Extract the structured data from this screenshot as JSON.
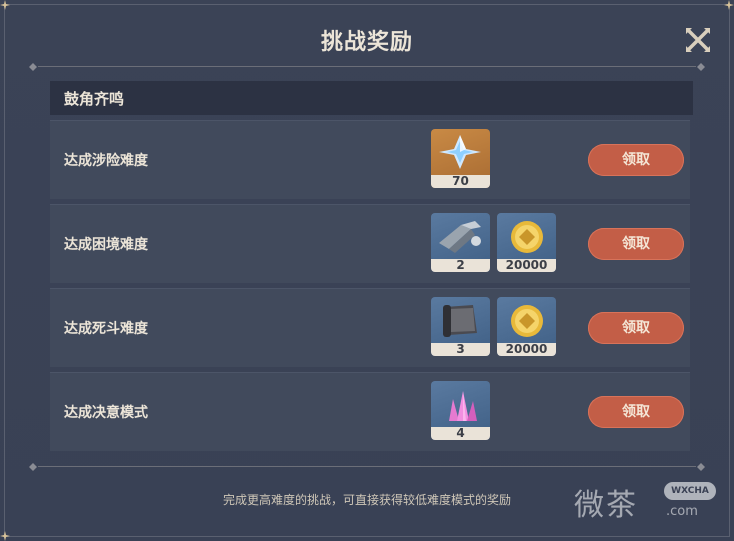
{
  "dialog": {
    "title": "挑战奖励",
    "section_title": "鼓角齐鸣",
    "footer_note": "完成更高难度的挑战，可直接获得较低难度模式的奖励"
  },
  "rows": [
    {
      "label": "达成涉险难度",
      "button": "领取",
      "items": [
        {
          "icon": "primogem-icon",
          "count": "70",
          "rarity": "orange"
        }
      ]
    },
    {
      "label": "达成困境难度",
      "button": "领取",
      "items": [
        {
          "icon": "weapon-ore-icon",
          "count": "2",
          "rarity": "blue"
        },
        {
          "icon": "mora-coin-icon",
          "count": "20000",
          "rarity": "blue"
        }
      ]
    },
    {
      "label": "达成死斗难度",
      "button": "领取",
      "items": [
        {
          "icon": "scroll-material-icon",
          "count": "3",
          "rarity": "blue"
        },
        {
          "icon": "mora-coin-icon",
          "count": "20000",
          "rarity": "blue"
        }
      ]
    },
    {
      "label": "达成决意模式",
      "button": "领取",
      "items": [
        {
          "icon": "crystal-icon",
          "count": "4",
          "rarity": "purple"
        }
      ]
    }
  ],
  "watermark": {
    "text": "微茶",
    "badge": "WXCHA",
    "url": ".com"
  },
  "colors": {
    "panel_bg": "#3b4356",
    "row_bg": "#414a5c",
    "header_bg": "#2c3243",
    "claim_button": "#c35e47",
    "text_light": "#ece5d8"
  }
}
